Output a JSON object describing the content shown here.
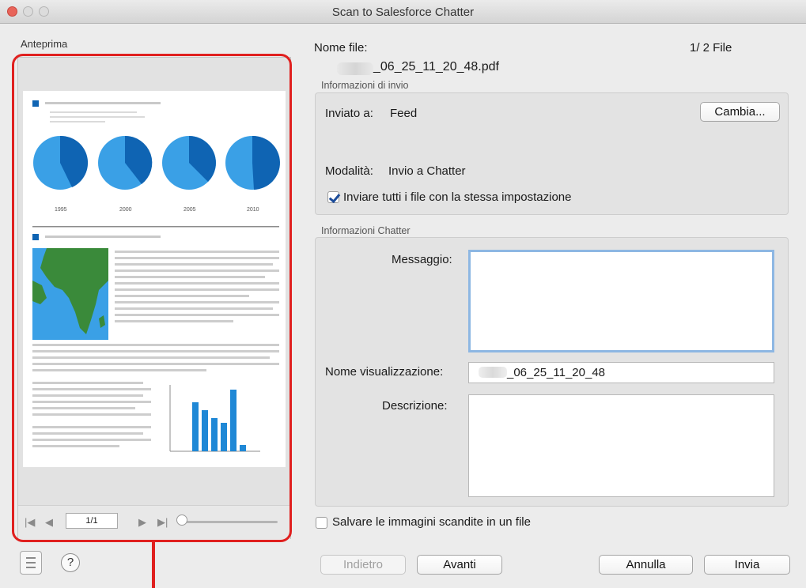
{
  "window": {
    "title": "Scan to Salesforce Chatter"
  },
  "preview": {
    "label": "Anteprima",
    "page_indicator": "1/1",
    "chart_years": [
      "1995",
      "2000",
      "2005",
      "2010"
    ]
  },
  "file": {
    "name_label": "Nome file:",
    "counter": "1/  2  File",
    "filename": "_06_25_11_20_48.pdf"
  },
  "send_info": {
    "section_label": "Informazioni di invio",
    "sent_to_label": "Inviato a:",
    "sent_to_value": "Feed",
    "change_button": "Cambia...",
    "mode_label": "Modalità:",
    "mode_value": "Invio a Chatter",
    "same_setting_label": "Inviare tutti i file con la stessa impostazione",
    "same_setting_checked": true
  },
  "chatter_info": {
    "section_label": "Informazioni Chatter",
    "message_label": "Messaggio:",
    "message_value": "",
    "display_name_label": "Nome visualizzazione:",
    "display_name_value": "_06_25_11_20_48",
    "description_label": "Descrizione:",
    "description_value": ""
  },
  "save_images": {
    "label": "Salvare le immagini scandite in un file",
    "checked": false
  },
  "buttons": {
    "back": "Indietro",
    "next": "Avanti",
    "cancel": "Annulla",
    "send": "Invia",
    "help": "?"
  },
  "colors": {
    "highlight": "#e0201f",
    "pie_dark": "#0f64b3",
    "pie_light": "#3aa0e6",
    "map_green": "#3a8a3a"
  }
}
